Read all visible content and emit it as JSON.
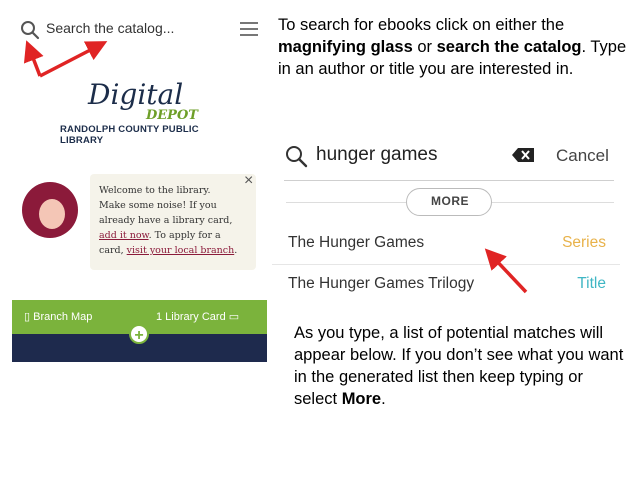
{
  "left_app": {
    "search_placeholder": "Search the catalog...",
    "logo": {
      "digital": "Digital",
      "depot": "DEPOT",
      "library": "RANDOLPH COUNTY PUBLIC LIBRARY"
    },
    "welcome": {
      "line1": "Welcome to the library.",
      "line2": "Make some noise! If you",
      "line3": "already have a library card,",
      "link_add": "add it now",
      "line4_after": ". To apply for a",
      "line5_before": "card, ",
      "link_branch": "visit your local branch",
      "line5_after": "."
    },
    "close_glyph": "×",
    "bottom_bar": {
      "branch_map_label": "Branch Map",
      "library_card_label": "1 Library Card",
      "plus_glyph": "+"
    }
  },
  "instruction_1": {
    "part1": "To search for ebooks click on either the ",
    "bold1": "magnifying glass",
    "part2": " or ",
    "bold2": "search the catalog",
    "part3": ". Type in an author or title you are interested in."
  },
  "search_demo": {
    "query": "hunger games",
    "cancel_label": "Cancel",
    "more_label": "MORE",
    "results": [
      {
        "title": "The Hunger Games",
        "type": "Series",
        "type_color": "#e8b24a"
      },
      {
        "title": "The Hunger Games Trilogy",
        "type": "Title",
        "type_color": "#3fb6c4"
      }
    ]
  },
  "instruction_2": {
    "part1": "As you type, a list of potential matches will appear below. If you don’t see what you want in the generated list then keep typing or select ",
    "bold": "More",
    "part2": "."
  },
  "colors": {
    "arrow_red": "#e02424",
    "brand_green": "#7bb33c",
    "brand_navy": "#1e2a4d",
    "accent_burgundy": "#8b1a3a"
  }
}
